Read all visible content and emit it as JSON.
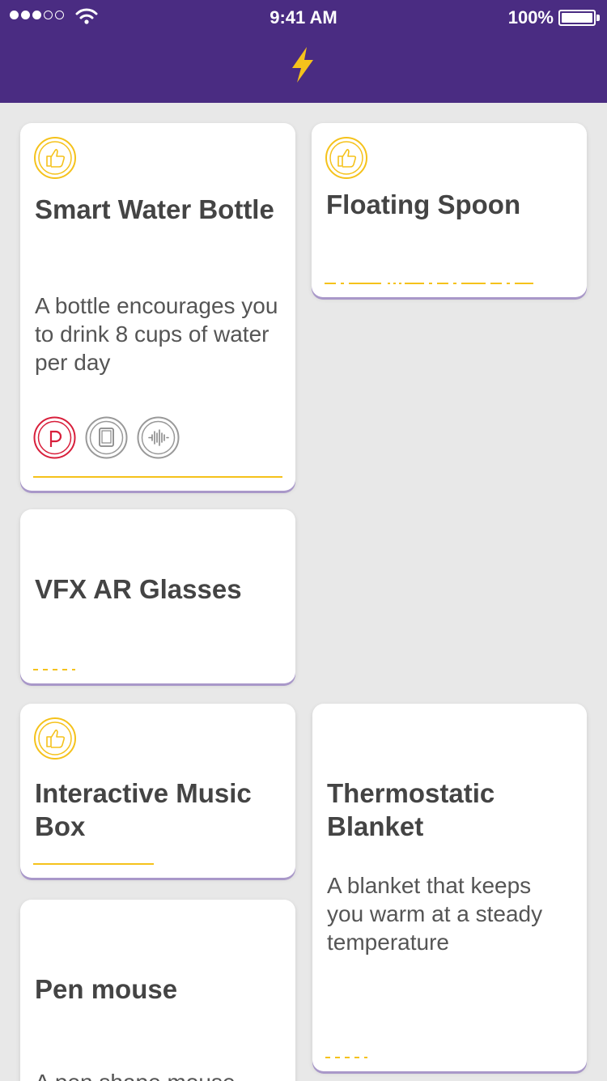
{
  "status": {
    "time": "9:41 AM",
    "battery": "100%"
  },
  "colors": {
    "header": "#4a2c82",
    "accent": "#f5c21b",
    "like_ring": "#f5c21b",
    "pin_icon": "#d81f3b"
  },
  "cards": [
    {
      "title": "Smart Water Bottle",
      "description": "A bottle encourages you to drink 8 cups of water per day",
      "liked": true,
      "icons": [
        "pinterest-icon",
        "tablet-icon",
        "soundwave-icon"
      ]
    },
    {
      "title": "Floating Spoon",
      "liked": true
    },
    {
      "title": "VFX AR Glasses",
      "liked": false
    },
    {
      "title": "Interactive Music Box",
      "liked": true
    },
    {
      "title": "Thermostatic Blanket",
      "description": "A blanket that keeps you warm at a steady temperature",
      "liked": false
    },
    {
      "title": "Pen mouse",
      "description": "A pen shape mouse",
      "liked": false
    }
  ]
}
